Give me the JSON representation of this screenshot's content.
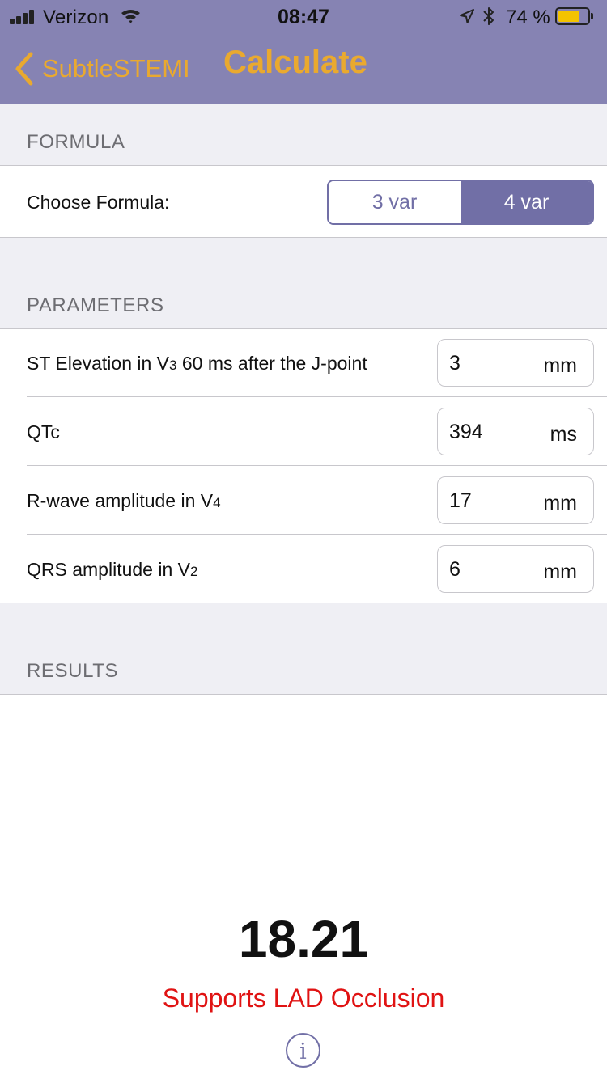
{
  "status_bar": {
    "carrier": "Verizon",
    "time": "08:47",
    "battery_percent": "74 %",
    "battery_level": 0.74,
    "battery_color": "#f3c300",
    "icons": [
      "signal-icon",
      "wifi-icon",
      "location-arrow-icon",
      "bluetooth-icon",
      "battery-icon"
    ]
  },
  "nav": {
    "back_label": "SubtleSTEMI",
    "title": "Calculate",
    "bar_color": "#8683b3",
    "accent_color": "#e9a92f",
    "back_icon": "chevron-left-icon"
  },
  "formula": {
    "section_title": "FORMULA",
    "label": "Choose Formula:",
    "options": [
      "3 var",
      "4 var"
    ],
    "selected": "4 var",
    "segment_color": "#716fa6"
  },
  "parameters": {
    "section_title": "PARAMETERS",
    "rows": [
      {
        "label_pre": "ST Elevation in V",
        "label_sub": "3",
        "label_post": " 60 ms after the J-point",
        "value": "3",
        "unit": "mm"
      },
      {
        "label_pre": "QTc",
        "label_sub": "",
        "label_post": "",
        "value": "394",
        "unit": "ms"
      },
      {
        "label_pre": "R-wave amplitude in V",
        "label_sub": "4",
        "label_post": "",
        "value": "17",
        "unit": "mm"
      },
      {
        "label_pre": "QRS amplitude in V",
        "label_sub": "2",
        "label_post": "",
        "value": "6",
        "unit": "mm"
      }
    ]
  },
  "results": {
    "section_title": "RESULTS",
    "value": "18.21",
    "interpretation": "Supports LAD Occlusion",
    "interpretation_color": "#e01313",
    "info_icon": "info-icon"
  }
}
